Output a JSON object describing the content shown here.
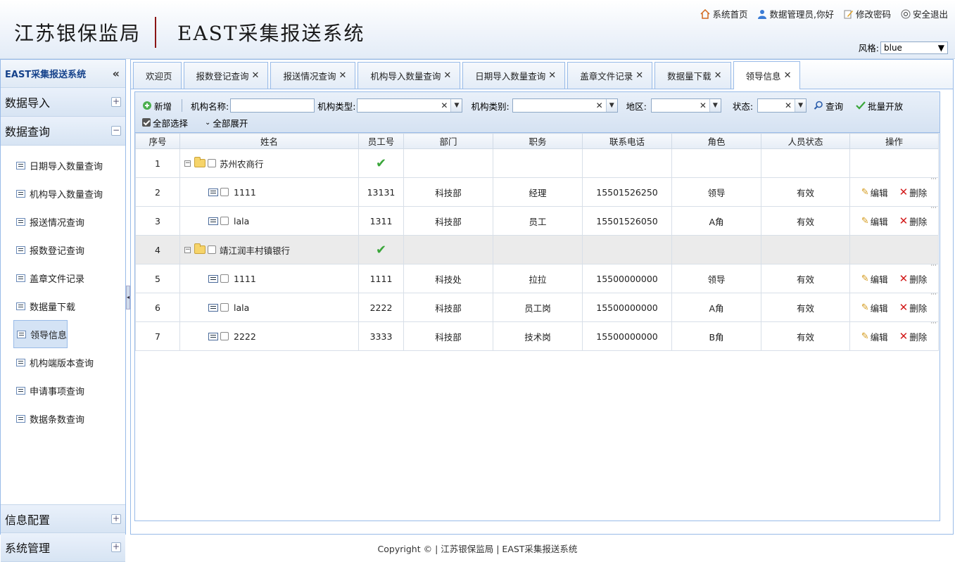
{
  "header": {
    "org": "江苏银保监局",
    "system": "EAST采集报送系统",
    "links": {
      "home": "系统首页",
      "user": "数据管理员,你好",
      "change_pwd": "修改密码",
      "logout": "安全退出"
    },
    "style_label": "风格:",
    "style_value": "blue"
  },
  "sidebar": {
    "title": "EAST采集报送系统",
    "collapse": "«",
    "sections": {
      "import": "数据导入",
      "query": "数据查询",
      "config": "信息配置",
      "system": "系统管理"
    },
    "items": [
      "日期导入数量查询",
      "机构导入数量查询",
      "报送情况查询",
      "报数登记查询",
      "盖章文件记录",
      "数据量下载",
      "领导信息",
      "机构端版本查询",
      "申请事项查询",
      "数据条数查询"
    ]
  },
  "tabs": [
    {
      "label": "欢迎页",
      "closable": false
    },
    {
      "label": "报数登记查询",
      "closable": true
    },
    {
      "label": "报送情况查询",
      "closable": true
    },
    {
      "label": "机构导入数量查询",
      "closable": true
    },
    {
      "label": "日期导入数量查询",
      "closable": true
    },
    {
      "label": "盖章文件记录",
      "closable": true
    },
    {
      "label": "数据量下载",
      "closable": true
    },
    {
      "label": "领导信息",
      "closable": true
    }
  ],
  "toolbar": {
    "add": "新增",
    "org_name_label": "机构名称:",
    "org_type_label": "机构类型:",
    "org_category_label": "机构类别:",
    "region_label": "地区:",
    "status_label": "状态:",
    "search": "查询",
    "batch_open": "批量开放",
    "select_all": "全部选择",
    "expand_all": "全部展开"
  },
  "grid": {
    "columns": [
      "序号",
      "姓名",
      "员工号",
      "部门",
      "职务",
      "联系电话",
      "角色",
      "人员状态",
      "操作"
    ],
    "edit_label": "编辑",
    "delete_label": "删除",
    "rows": [
      {
        "no": "1",
        "type": "group",
        "name": "苏州农商行",
        "checked_icon": true
      },
      {
        "no": "2",
        "type": "leaf",
        "name": "1111",
        "emp": "13131",
        "dept": "科技部",
        "post": "经理",
        "phone": "15501526250",
        "role": "领导",
        "status": "有效"
      },
      {
        "no": "3",
        "type": "leaf",
        "name": "lala",
        "emp": "1311",
        "dept": "科技部",
        "post": "员工",
        "phone": "15501526050",
        "role": "A角",
        "status": "有效"
      },
      {
        "no": "4",
        "type": "group",
        "name": "靖江润丰村镇银行",
        "checked_icon": true,
        "alt": true
      },
      {
        "no": "5",
        "type": "leaf",
        "name": "1111",
        "emp": "1111",
        "dept": "科技处",
        "post": "拉拉",
        "phone": "15500000000",
        "role": "领导",
        "status": "有效"
      },
      {
        "no": "6",
        "type": "leaf",
        "name": "lala",
        "emp": "2222",
        "dept": "科技部",
        "post": "员工岗",
        "phone": "15500000000",
        "role": "A角",
        "status": "有效"
      },
      {
        "no": "7",
        "type": "leaf",
        "name": "2222",
        "emp": "3333",
        "dept": "科技部",
        "post": "技术岗",
        "phone": "15500000000",
        "role": "B角",
        "status": "有效"
      }
    ]
  },
  "footer": "Copyright © | 江苏银保监局 | EAST采集报送系统"
}
